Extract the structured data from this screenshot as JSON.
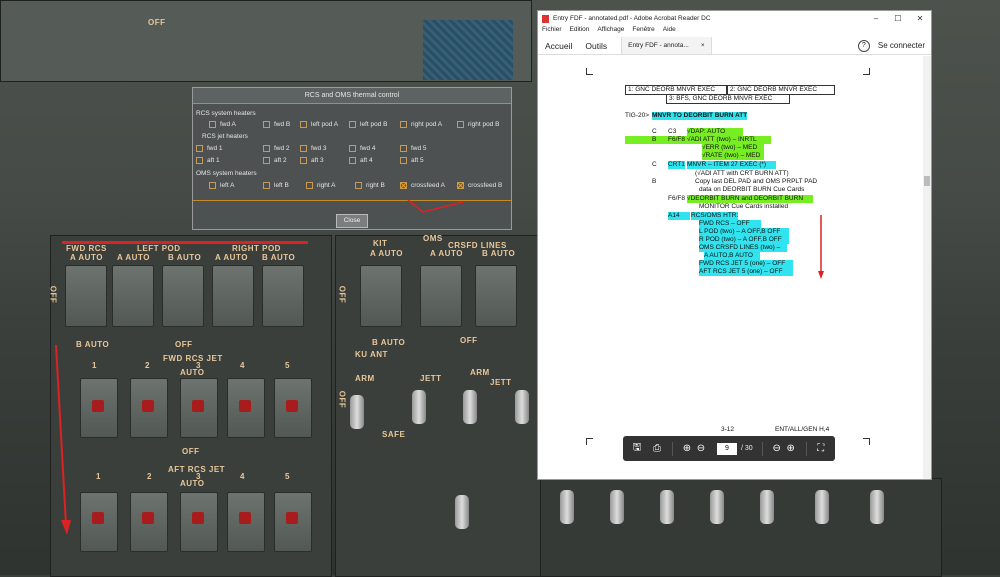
{
  "cockpit": {
    "labels": {
      "off_top": "OFF",
      "fwd_rcs": "FWD RCS",
      "left_pod": "LEFT POD",
      "right_pod": "RIGHT POD",
      "a_auto_1": "A AUTO",
      "a_auto_2": "A AUTO",
      "b_auto_1": "B AUTO",
      "a_auto_3": "A AUTO",
      "b_auto_2": "B AUTO",
      "kit": "KIT",
      "oms": "OMS",
      "crsfd_lines": "CRSFD LINES",
      "a_auto_kit": "A AUTO",
      "a_auto_oms": "A AUTO",
      "b_auto_oms": "B AUTO",
      "b_auto_left": "B AUTO",
      "off_mid": "OFF",
      "fwd_rcs_jet": "FWD RCS JET",
      "auto_mid": "AUTO",
      "off_lower": "OFF",
      "aft_rcs_jet": "AFT RCS JET",
      "auto_lower": "AUTO",
      "b_auto_mid": "B AUTO",
      "off_center": "OFF",
      "klj_ant": "KU ANT",
      "arm": "ARM",
      "jett": "JETT",
      "arm2": "ARM",
      "jett2": "JETT",
      "safe": "SAFE",
      "off_side": "OFF",
      "off_side2": "OFF",
      "off_side3": "OFF",
      "n1": "1",
      "n2": "2",
      "n3": "3",
      "n4": "4",
      "n5": "5",
      "m1": "1",
      "m2": "2",
      "m3": "3",
      "m4": "4",
      "m5": "5"
    },
    "accent_color": "#e9c79a",
    "annotation_color": "#dd2222"
  },
  "rcs_dialog": {
    "title": "RCS and OMS thermal control",
    "rcs_system_heaters": "RCS system heaters",
    "rcs_jet_heaters": "RCS jet heaters",
    "oms_system_heaters": "OMS system heaters",
    "row1": [
      "fwd A",
      "fwd B",
      "left pod A",
      "left pod B",
      "right pod A",
      "right pod B"
    ],
    "row2": [
      "fwd 1",
      "fwd 2",
      "fwd 3",
      "fwd 4",
      "fwd 5"
    ],
    "row3": [
      "aft 1",
      "aft 2",
      "aft 3",
      "aft 4",
      "aft 5"
    ],
    "row4": [
      "left A",
      "left B",
      "right A",
      "right B",
      "crossfeed A",
      "crossfeed B"
    ],
    "row4_checked": [
      false,
      false,
      false,
      false,
      true,
      true
    ],
    "close": "Close"
  },
  "acrobat": {
    "window_title": "Entry FDF - annotated.pdf - Adobe Acrobat Reader DC",
    "menu": [
      "Fichier",
      "Edition",
      "Affichage",
      "Fenêtre",
      "Aide"
    ],
    "home": "Accueil",
    "tools": "Outils",
    "tab_title": "Entry FDF - annota...",
    "tab_close": "×",
    "help": "?",
    "signin": "Se connecter",
    "page_number": "9",
    "page_total": "/ 30",
    "pdf": {
      "box1": "1:  GNC DEORB MNVR EXEC",
      "box2": "2:  GNC DEORB MNVR EXEC",
      "box3": "3:  BFS, GNC DEORB MNVR EXEC",
      "tig": "TIG-20>",
      "heading": "MNVR TO DEORBIT BURN ATT",
      "l1a": "C",
      "l1b": "C3",
      "l1c": "√DAP:  AUTO",
      "l2a": "B",
      "l2b": "F6/F8",
      "l2c": "√ADI ATT (two)   – INRTL",
      "l3": "√ERR (two)   – MED",
      "l4": "√RATE (two) – MED",
      "l5a": "C",
      "l5b": "CRT1",
      "l5c": "MNVR – ITEM 27 EXEC (*)",
      "l6": "(√ADI ATT with CRT BURN ATT)",
      "l7a": "B",
      "l7b": "Copy last DEL PAD and OMS PRPLT PAD",
      "l8": "data on DEORBIT BURN Cue Cards",
      "l9a": "F6/F8",
      "l9b": "√DEORBIT BURN and DEORBIT BURN",
      "l10": "MONITOR Cue Cards installed",
      "l11a": "A14",
      "l11b": "RCS/OMS HTR:",
      "l12": "FWD RCS     – OFF",
      "l13": "L POD (two) – A OFF,B OFF",
      "l14": "R POD (two) – A OFF,B OFF",
      "l15": "OMS CRSFD LINES (two) –",
      "l16": "A AUTO,B AUTO",
      "l17": "FWD RCS JET 5 (one) – OFF",
      "l18": "AFT RCS JET 5 (one) – OFF",
      "footer_left": "3-12",
      "footer_right": "ENT/ALL/GEN H,4"
    }
  }
}
